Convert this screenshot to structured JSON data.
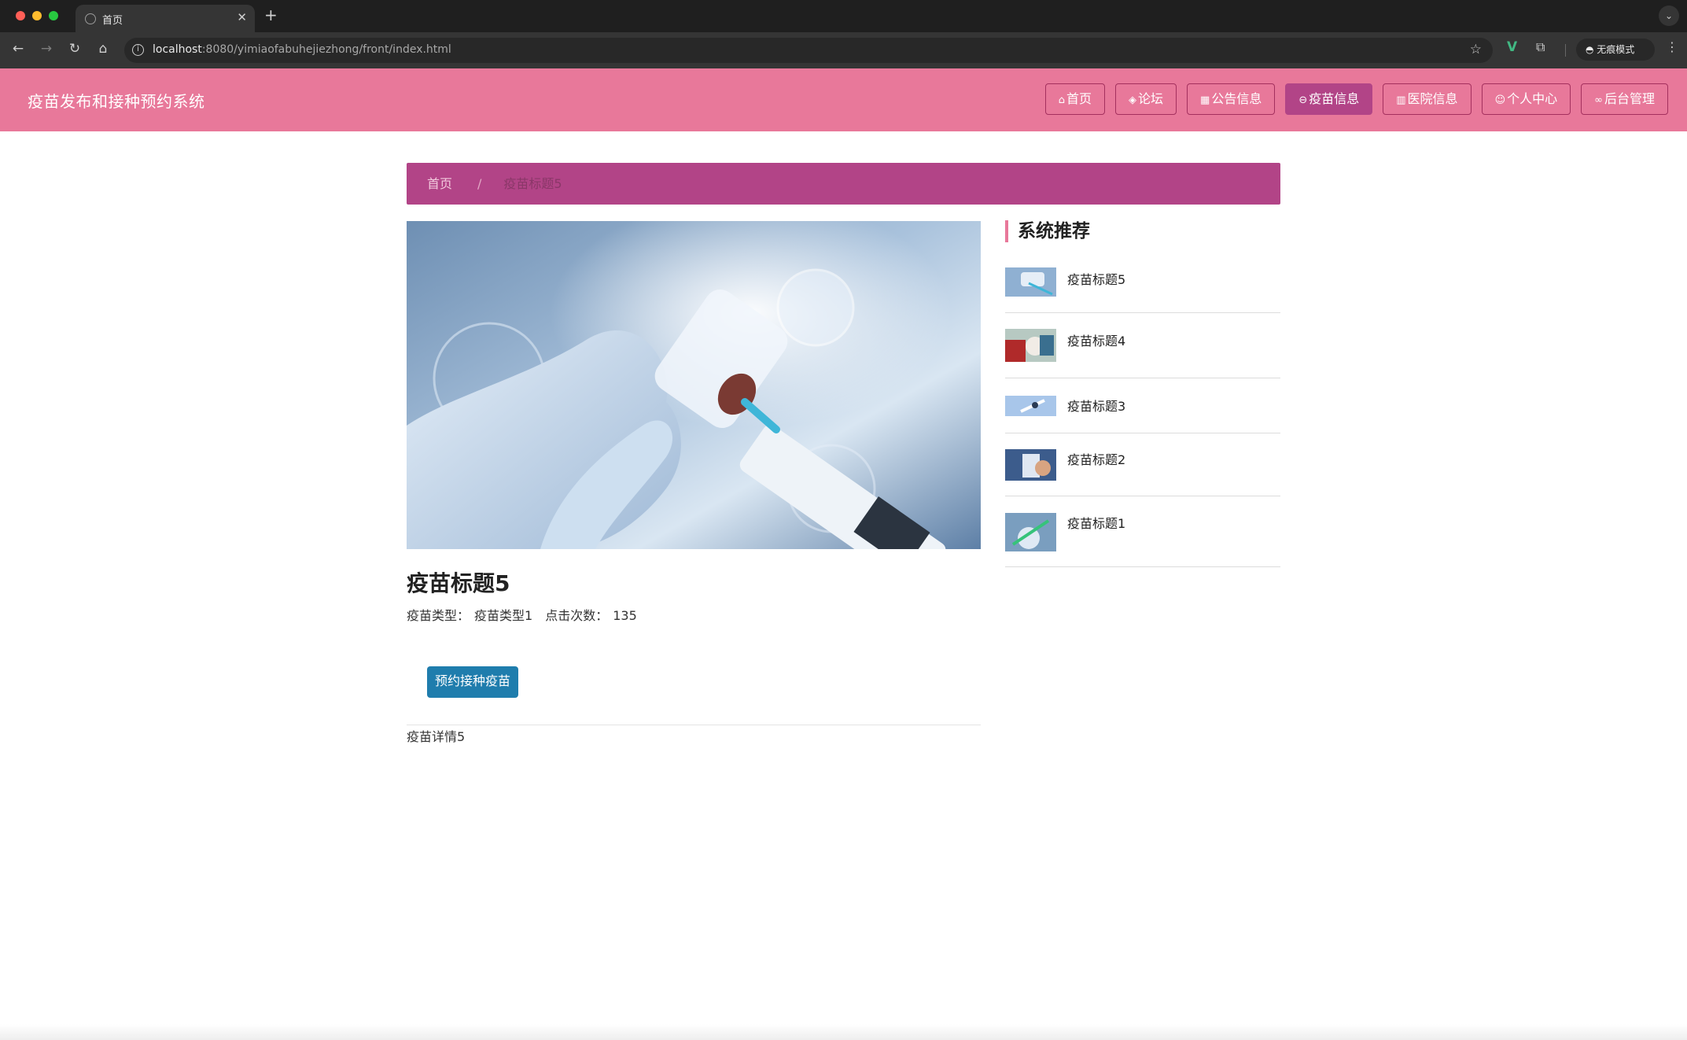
{
  "browser": {
    "tab_title": "首页",
    "url_host": "localhost",
    "url_rest": ":8080/yimiaofabuhejiezhong/front/index.html",
    "incognito_label": "无痕模式"
  },
  "header": {
    "site_title": "疫苗发布和接种预约系统",
    "nav": [
      {
        "label": "首页",
        "icon": "home-icon"
      },
      {
        "label": "论坛",
        "icon": "layers-icon"
      },
      {
        "label": "公告信息",
        "icon": "grid-icon"
      },
      {
        "label": "疫苗信息",
        "icon": "minus-circle-icon",
        "active": true
      },
      {
        "label": "医院信息",
        "icon": "building-icon"
      },
      {
        "label": "个人中心",
        "icon": "user-icon"
      },
      {
        "label": "后台管理",
        "icon": "link-icon"
      }
    ],
    "accent_color": "#e8789a",
    "active_color": "#b24487"
  },
  "breadcrumb": {
    "home": "首页",
    "separator": "/",
    "current": "疫苗标题5"
  },
  "detail": {
    "title": "疫苗标题5",
    "type_label": "疫苗类型：",
    "type_value": "疫苗类型1",
    "clicks_label": "点击次数：",
    "clicks_value": "135",
    "book_button": "预约接种疫苗",
    "description": "疫苗详情5",
    "button_color": "#1f7dad"
  },
  "sidebar": {
    "heading": "系统推荐",
    "items": [
      {
        "title": "疫苗标题5"
      },
      {
        "title": "疫苗标题4"
      },
      {
        "title": "疫苗标题3"
      },
      {
        "title": "疫苗标题2"
      },
      {
        "title": "疫苗标题1"
      }
    ]
  }
}
